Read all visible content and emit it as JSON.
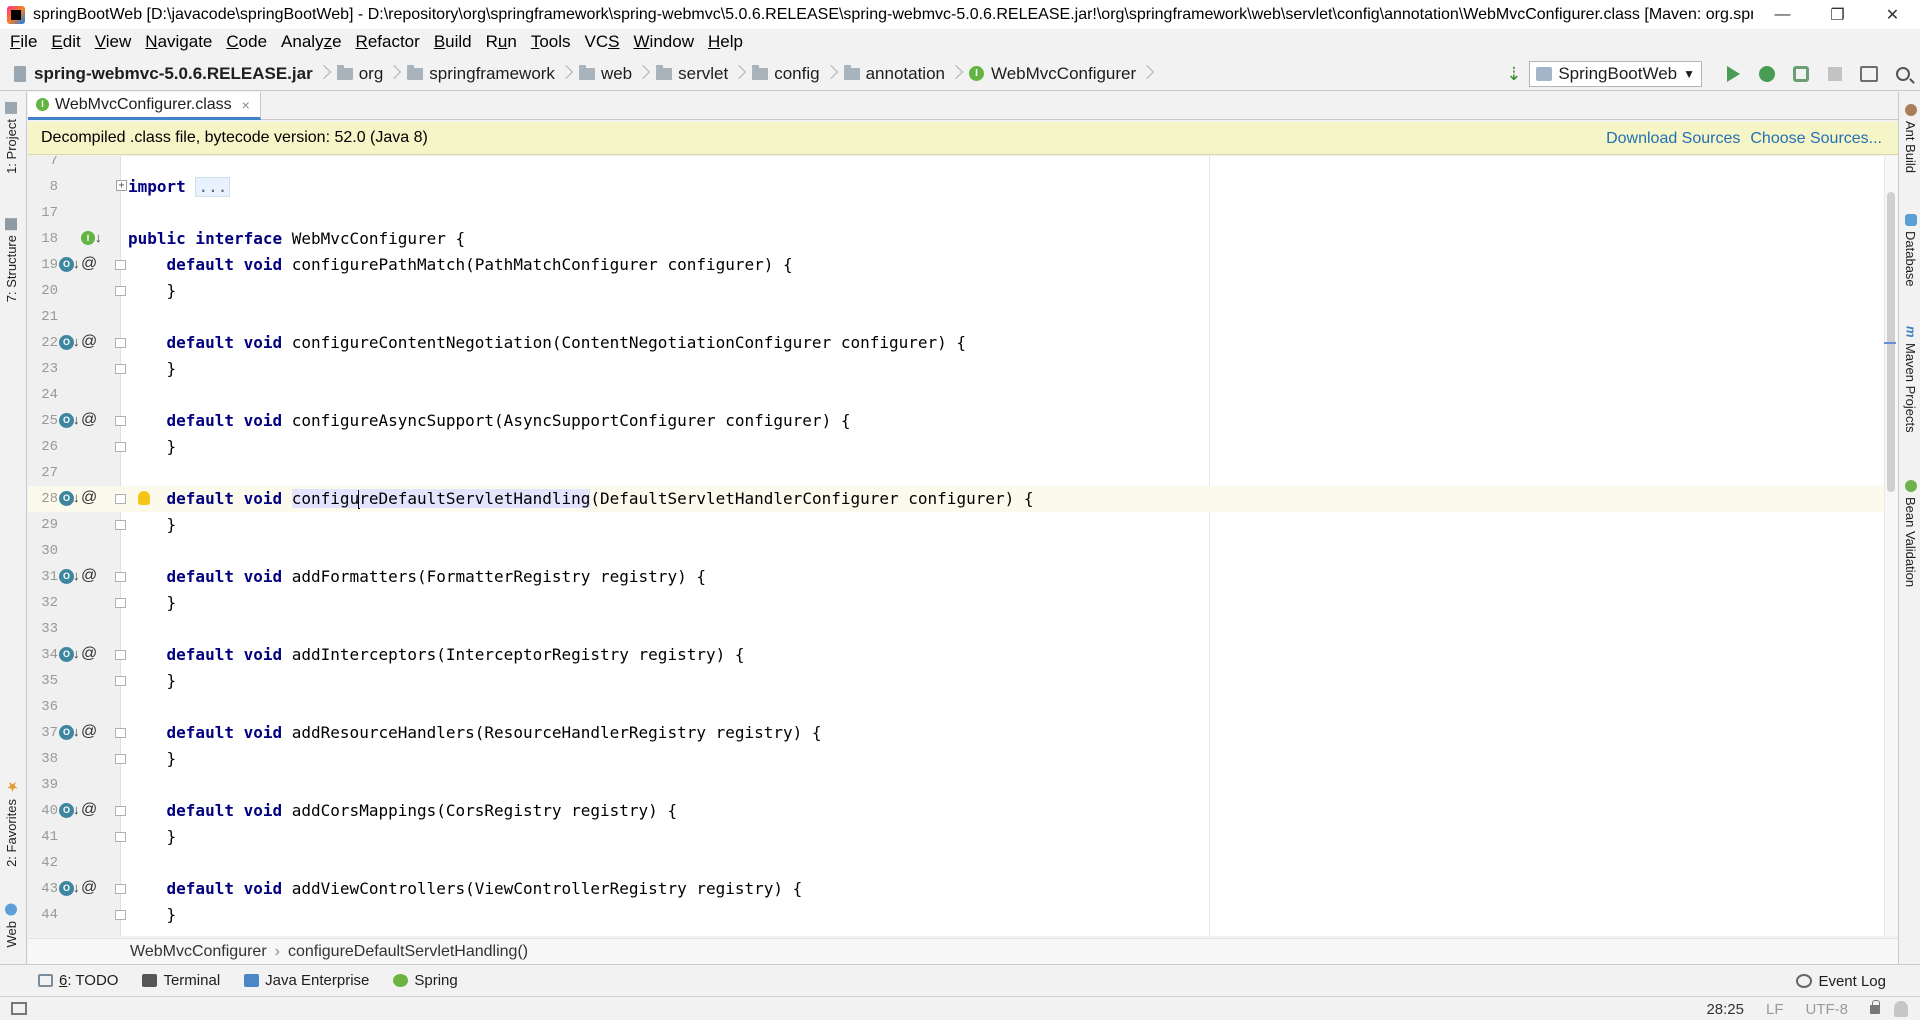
{
  "window": {
    "title": "springBootWeb [D:\\javacode\\springBootWeb] - D:\\repository\\org\\springframework\\spring-webmvc\\5.0.6.RELEASE\\spring-webmvc-5.0.6.RELEASE.jar!\\org\\springframework\\web\\servlet\\config\\annotation\\WebMvcConfigurer.class [Maven: org.springframework...",
    "minimize": "—",
    "restore": "❐",
    "close": "✕"
  },
  "menu": [
    {
      "u": "F",
      "rest": "ile"
    },
    {
      "u": "E",
      "rest": "dit"
    },
    {
      "u": "V",
      "rest": "iew"
    },
    {
      "u": "N",
      "rest": "avigate"
    },
    {
      "u": "C",
      "rest": "ode"
    },
    {
      "pre": "Analy",
      "u": "z",
      "rest": "e"
    },
    {
      "u": "R",
      "rest": "efactor"
    },
    {
      "u": "B",
      "rest": "uild"
    },
    {
      "pre": "R",
      "u": "u",
      "rest": "n"
    },
    {
      "u": "T",
      "rest": "ools"
    },
    {
      "pre": "VC",
      "u": "S",
      "rest": ""
    },
    {
      "u": "W",
      "rest": "indow"
    },
    {
      "u": "H",
      "rest": "elp"
    }
  ],
  "nav": {
    "crumbs": [
      "spring-webmvc-5.0.6.RELEASE.jar",
      "org",
      "springframework",
      "web",
      "servlet",
      "config",
      "annotation",
      "WebMvcConfigurer"
    ],
    "run_config": "SpringBootWeb"
  },
  "tab": {
    "label": "WebMvcConfigurer.class",
    "close": "×"
  },
  "banner": {
    "text": "Decompiled .class file, bytecode version: 52.0 (Java 8)",
    "download_sources": "Download Sources",
    "choose_sources": "Choose Sources..."
  },
  "left_tools": [
    {
      "label": "1: Project"
    },
    {
      "label": "7: Structure"
    },
    {
      "label": "2: Favorites"
    },
    {
      "label": "Web"
    }
  ],
  "right_tools": [
    {
      "label": "Ant Build"
    },
    {
      "label": "Database"
    },
    {
      "label": "Maven Projects"
    },
    {
      "label": "Bean Validation"
    }
  ],
  "editor": {
    "lines": [
      {
        "n": "7",
        "segs": []
      },
      {
        "n": "8",
        "fold": "plus",
        "segs": [
          {
            "t": "import",
            "c": "kw"
          },
          {
            "t": " "
          },
          {
            "t": "...",
            "c": "fold-box"
          }
        ]
      },
      {
        "n": "17",
        "segs": []
      },
      {
        "n": "18",
        "iface": true,
        "segs": [
          {
            "t": "public interface",
            "c": "kw"
          },
          {
            "t": " WebMvcConfigurer {"
          }
        ]
      },
      {
        "n": "19",
        "impl": true,
        "fold": "box",
        "segs": [
          {
            "t": "    "
          },
          {
            "t": "default void",
            "c": "kw"
          },
          {
            "t": " configurePathMatch(PathMatchConfigurer configurer) {"
          }
        ]
      },
      {
        "n": "20",
        "fold": "box",
        "segs": [
          {
            "t": "    }"
          }
        ]
      },
      {
        "n": "21",
        "segs": []
      },
      {
        "n": "22",
        "impl": true,
        "fold": "box",
        "segs": [
          {
            "t": "    "
          },
          {
            "t": "default void",
            "c": "kw"
          },
          {
            "t": " configureContentNegotiation(ContentNegotiationConfigurer configurer) {"
          }
        ]
      },
      {
        "n": "23",
        "fold": "box",
        "segs": [
          {
            "t": "    }"
          }
        ]
      },
      {
        "n": "24",
        "segs": []
      },
      {
        "n": "25",
        "impl": true,
        "fold": "box",
        "segs": [
          {
            "t": "    "
          },
          {
            "t": "default void",
            "c": "kw"
          },
          {
            "t": " configureAsyncSupport(AsyncSupportConfigurer configurer) {"
          }
        ]
      },
      {
        "n": "26",
        "fold": "box",
        "segs": [
          {
            "t": "    }"
          }
        ]
      },
      {
        "n": "27",
        "segs": []
      },
      {
        "n": "28",
        "impl": true,
        "fold": "box",
        "bulb": true,
        "current": true,
        "segs": [
          {
            "t": "    "
          },
          {
            "t": "default void",
            "c": "kw"
          },
          {
            "t": " "
          },
          {
            "t": "configu",
            "c": "hl"
          },
          {
            "caret": true
          },
          {
            "t": "reDefaultServletHandling",
            "c": "hl"
          },
          {
            "t": "(DefaultServletHandlerConfigurer configurer) {"
          }
        ]
      },
      {
        "n": "29",
        "fold": "box",
        "segs": [
          {
            "t": "    }"
          }
        ]
      },
      {
        "n": "30",
        "segs": []
      },
      {
        "n": "31",
        "impl": true,
        "fold": "box",
        "segs": [
          {
            "t": "    "
          },
          {
            "t": "default void",
            "c": "kw"
          },
          {
            "t": " addFormatters(FormatterRegistry registry) {"
          }
        ]
      },
      {
        "n": "32",
        "fold": "box",
        "segs": [
          {
            "t": "    }"
          }
        ]
      },
      {
        "n": "33",
        "segs": []
      },
      {
        "n": "34",
        "impl": true,
        "fold": "box",
        "segs": [
          {
            "t": "    "
          },
          {
            "t": "default void",
            "c": "kw"
          },
          {
            "t": " addInterceptors(InterceptorRegistry registry) {"
          }
        ]
      },
      {
        "n": "35",
        "fold": "box",
        "segs": [
          {
            "t": "    }"
          }
        ]
      },
      {
        "n": "36",
        "segs": []
      },
      {
        "n": "37",
        "impl": true,
        "fold": "box",
        "segs": [
          {
            "t": "    "
          },
          {
            "t": "default void",
            "c": "kw"
          },
          {
            "t": " addResourceHandlers(ResourceHandlerRegistry registry) {"
          }
        ]
      },
      {
        "n": "38",
        "fold": "box",
        "segs": [
          {
            "t": "    }"
          }
        ]
      },
      {
        "n": "39",
        "segs": []
      },
      {
        "n": "40",
        "impl": true,
        "fold": "box",
        "segs": [
          {
            "t": "    "
          },
          {
            "t": "default void",
            "c": "kw"
          },
          {
            "t": " addCorsMappings(CorsRegistry registry) {"
          }
        ]
      },
      {
        "n": "41",
        "fold": "box",
        "segs": [
          {
            "t": "    }"
          }
        ]
      },
      {
        "n": "42",
        "segs": []
      },
      {
        "n": "43",
        "impl": true,
        "fold": "box",
        "segs": [
          {
            "t": "    "
          },
          {
            "t": "default void",
            "c": "kw"
          },
          {
            "t": " addViewControllers(ViewControllerRegistry registry) {"
          }
        ]
      },
      {
        "n": "44",
        "fold": "box",
        "segs": [
          {
            "t": "    }"
          }
        ]
      }
    ]
  },
  "code_crumbs": {
    "class": "WebMvcConfigurer",
    "method": "configureDefaultServletHandling()",
    "sep": "›"
  },
  "bottom_tools": {
    "todo_u": "6",
    "todo_rest": ": TODO",
    "terminal": "Terminal",
    "java_enterprise": "Java Enterprise",
    "spring": "Spring",
    "event_log": "Event Log"
  },
  "status": {
    "position": "28:25",
    "line_sep": "LF",
    "encoding": "UTF-8"
  },
  "colors": {
    "keyword": "#000080",
    "banner_bg": "#f5f5c8",
    "link": "#2470b3",
    "run_green": "#499c54"
  }
}
